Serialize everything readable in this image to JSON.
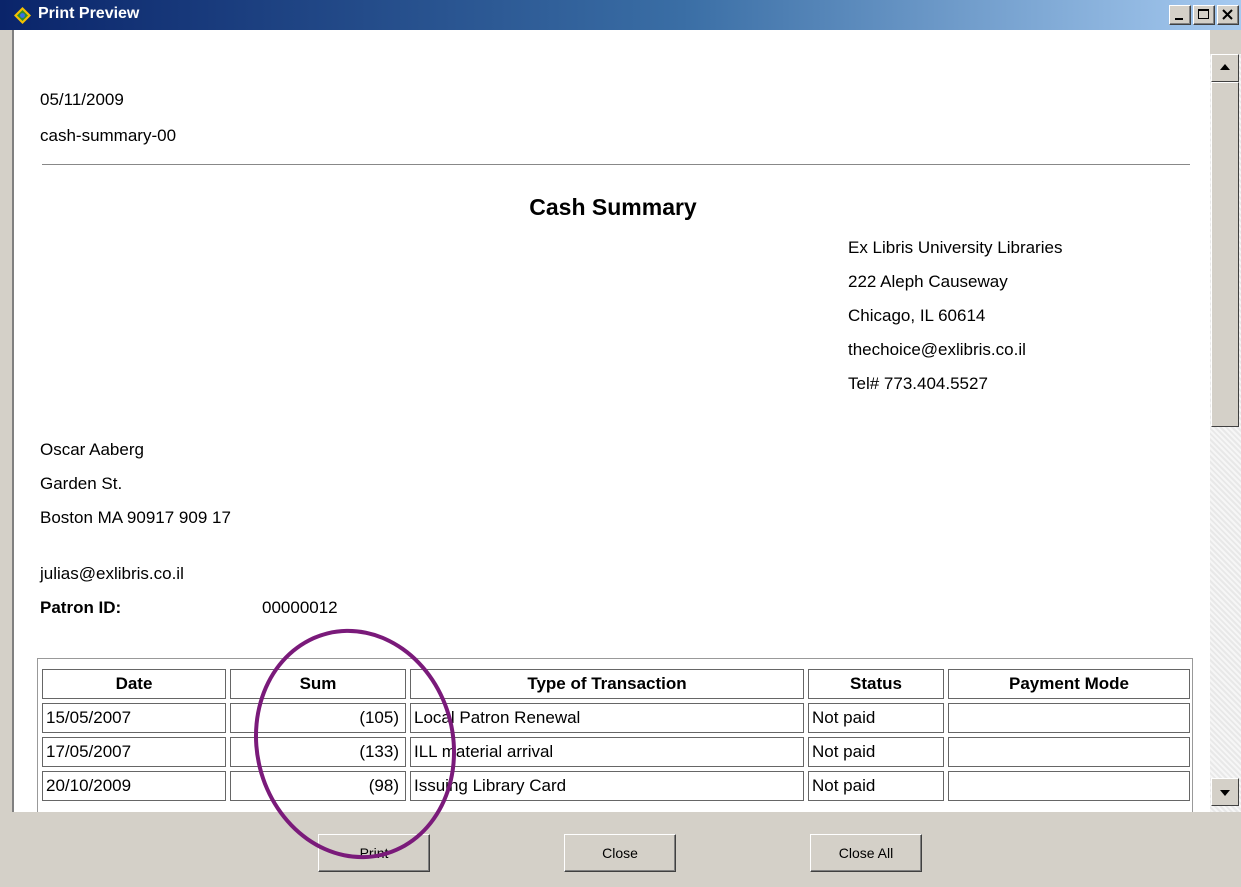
{
  "window": {
    "title": "Print Preview"
  },
  "report": {
    "date": "05/11/2009",
    "report_id": "cash-summary-00",
    "title": "Cash Summary",
    "library": {
      "name": "Ex Libris University Libraries",
      "street": "222 Aleph Causeway",
      "city": "Chicago, IL 60614",
      "email": "thechoice@exlibris.co.il",
      "tel": "Tel# 773.404.5527"
    },
    "patron": {
      "name": "Oscar Aaberg",
      "street": "Garden St.",
      "city": "Boston MA 90917 909 17",
      "email": "julias@exlibris.co.il",
      "id_label": "Patron ID:",
      "id_value": "00000012"
    },
    "table": {
      "headers": [
        "Date",
        "Sum",
        "Type of Transaction",
        "Status",
        "Payment Mode"
      ],
      "rows": [
        [
          "15/05/2007",
          "(105)",
          "Local Patron Renewal",
          "Not paid",
          ""
        ],
        [
          "17/05/2007",
          "(133)",
          "ILL material arrival",
          "Not paid",
          ""
        ],
        [
          "20/10/2009",
          "(98)",
          "Issuing Library Card",
          "Not paid",
          ""
        ]
      ]
    }
  },
  "buttons": {
    "print": "Print",
    "close": "Close",
    "close_all": "Close All"
  },
  "colors": {
    "annotation": "#7a1a7a",
    "titlebar": "#0a246a"
  }
}
